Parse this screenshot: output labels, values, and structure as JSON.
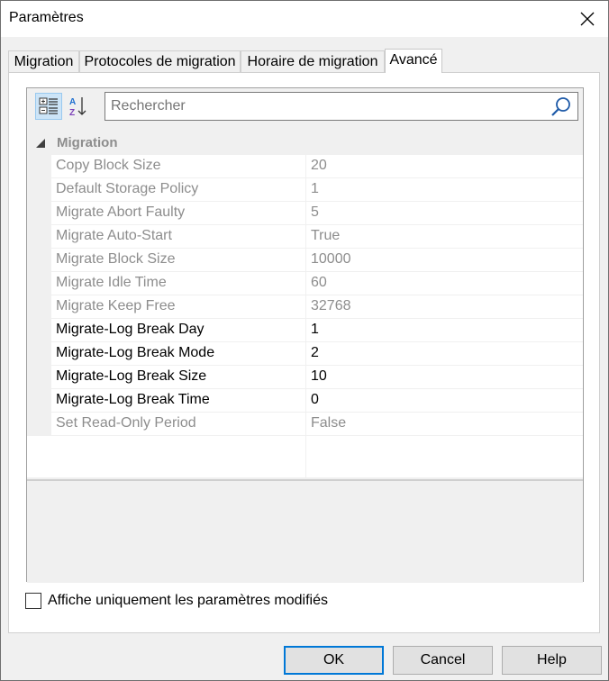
{
  "window": {
    "title": "Paramètres"
  },
  "tabs": [
    {
      "label": "Migration",
      "active": false
    },
    {
      "label": "Protocoles de migration",
      "active": false
    },
    {
      "label": "Horaire de migration",
      "active": false
    },
    {
      "label": "Avancé",
      "active": true
    }
  ],
  "toolbar": {
    "categorized_icon": "categorized-view-icon",
    "alphabetical_icon": "sort-alphabetical-icon"
  },
  "search": {
    "placeholder": "Rechercher",
    "value": "",
    "icon": "search-icon"
  },
  "grid": {
    "category": {
      "label": "Migration",
      "expanded": true
    },
    "properties": [
      {
        "name": "Copy Block Size",
        "value": "20",
        "editable": false
      },
      {
        "name": "Default Storage Policy",
        "value": "1",
        "editable": false
      },
      {
        "name": "Migrate Abort Faulty",
        "value": "5",
        "editable": false
      },
      {
        "name": "Migrate Auto-Start",
        "value": "True",
        "editable": false
      },
      {
        "name": "Migrate Block Size",
        "value": "10000",
        "editable": false
      },
      {
        "name": "Migrate Idle Time",
        "value": "60",
        "editable": false
      },
      {
        "name": "Migrate Keep Free",
        "value": "32768",
        "editable": false
      },
      {
        "name": "Migrate-Log Break Day",
        "value": "1",
        "editable": true
      },
      {
        "name": "Migrate-Log Break Mode",
        "value": "2",
        "editable": true
      },
      {
        "name": "Migrate-Log Break Size",
        "value": "10",
        "editable": true
      },
      {
        "name": "Migrate-Log Break Time",
        "value": "0",
        "editable": true
      },
      {
        "name": "Set Read-Only Period",
        "value": "False",
        "editable": false
      }
    ]
  },
  "options": {
    "show_modified_only_label": "Affiche uniquement les paramètres modifiés",
    "show_modified_only_checked": false
  },
  "footer": {
    "ok_label": "OK",
    "cancel_label": "Cancel",
    "help_label": "Help"
  },
  "colors": {
    "accent": "#0078d7",
    "readonly_text": "#8d8d8d"
  }
}
